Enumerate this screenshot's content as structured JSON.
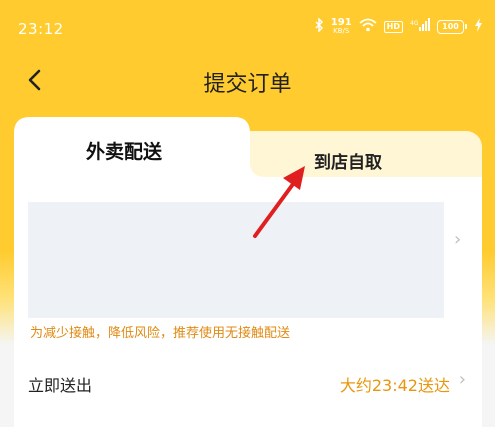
{
  "status_bar": {
    "time": "23:12",
    "net_speed_value": "191",
    "net_speed_unit": "KB/S",
    "hd_badge": "HD",
    "battery_level": "100",
    "icons": [
      "bluetooth-icon",
      "wifi-icon",
      "cellular-signal-icon",
      "battery-icon",
      "charging-icon"
    ]
  },
  "header": {
    "title": "提交订单",
    "back_icon": "chevron-left-icon"
  },
  "tabs": [
    {
      "label": "外卖配送",
      "active": true
    },
    {
      "label": "到店自取",
      "active": false
    }
  ],
  "delivery": {
    "notice": "为减少接触，降低风险，推荐使用无接触配送",
    "time_row": {
      "label": "立即送出",
      "value": "大约23:42送达"
    }
  },
  "colors": {
    "brand_yellow": "#FFCB2E",
    "accent_orange": "#E8960C",
    "annotation_red": "#E02020"
  }
}
